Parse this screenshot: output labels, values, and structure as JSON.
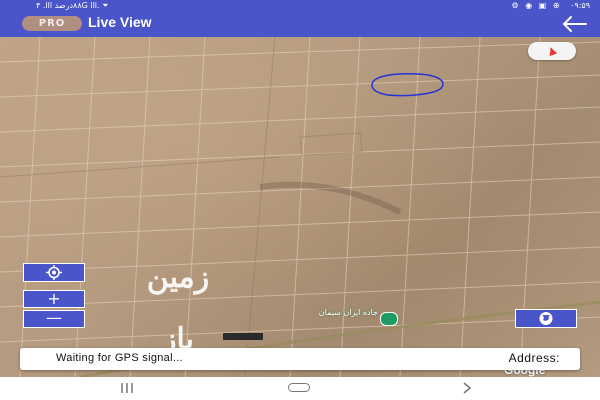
{
  "status_bar": {
    "left_text": "٨٨درصد ااا. ۴G ااا. ⏷",
    "time": "۰۹:۵۹"
  },
  "app_bar": {
    "pro_badge": "PRO",
    "title": "Live View",
    "back_icon": "arrow-left-icon"
  },
  "map": {
    "compass_icon": "compass-icon",
    "locate_icon": "crosshair-locate-icon",
    "zoom_in": "+",
    "zoom_out": "—",
    "globe_icon": "globe-icon",
    "road_label": "جاده ایران سیمان",
    "watermark": "زمین باز",
    "google_logo": "Google"
  },
  "info_card": {
    "gps_status": "Waiting for GPS signal...",
    "address_label": "Address:"
  },
  "nav_bar": {
    "recents_icon": "recents-icon",
    "home_icon": "home-icon",
    "back_icon": "back-chevron-icon"
  },
  "colors": {
    "primary": "#4a55c9",
    "pro_badge": "#b08e80",
    "location_circle": "#2433d6",
    "road_marker": "#1e9a63"
  }
}
